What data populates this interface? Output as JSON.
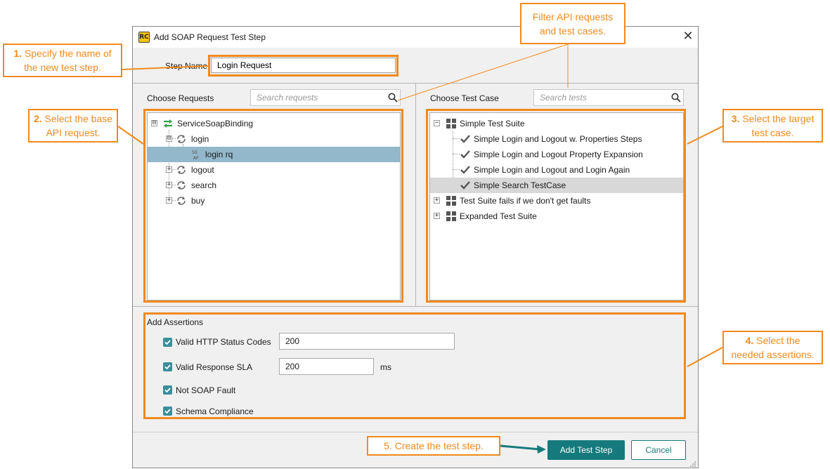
{
  "dialog": {
    "title": "Add SOAP Request Test Step",
    "app_icon_text": "RC",
    "close_glyph": "✕",
    "step_name_label": "Step Name:",
    "step_name_value": "Login Request"
  },
  "requests_pane": {
    "label": "Choose Requests",
    "search_placeholder": "Search requests",
    "tree": [
      {
        "label": "ServiceSoapBinding",
        "expander": "⊟",
        "icon": "binding-icon"
      },
      {
        "label": "login",
        "expander": "⊟",
        "icon": "operation-icon"
      },
      {
        "label": "login rq",
        "icon": "soap-request-icon",
        "selected": true
      },
      {
        "label": "logout",
        "expander": "+",
        "icon": "operation-icon"
      },
      {
        "label": "search",
        "expander": "+",
        "icon": "operation-icon"
      },
      {
        "label": "buy",
        "expander": "+",
        "icon": "operation-icon"
      }
    ]
  },
  "testcase_pane": {
    "label": "Choose Test Case",
    "search_placeholder": "Search tests",
    "tree": [
      {
        "label": "Simple Test Suite",
        "expander": "−",
        "icon": "test-suite-icon"
      },
      {
        "label": "Simple Login and Logout w. Properties Steps",
        "icon": "checkmark-icon"
      },
      {
        "label": "Simple Login and Logout Property Expansion",
        "icon": "checkmark-icon"
      },
      {
        "label": "Simple Login and Logout and Login Again",
        "icon": "checkmark-icon"
      },
      {
        "label": "Simple Search TestCase",
        "icon": "checkmark-icon",
        "selected": true
      },
      {
        "label": "Test Suite fails if we don't get faults",
        "expander": "+",
        "icon": "test-suite-icon"
      },
      {
        "label": "Expanded Test Suite",
        "expander": "+",
        "icon": "test-suite-icon"
      }
    ]
  },
  "assertions": {
    "title": "Add Assertions",
    "items": [
      {
        "label": "Valid HTTP Status Codes",
        "checked": true,
        "value": "200"
      },
      {
        "label": "Valid Response SLA",
        "checked": true,
        "value": "200",
        "unit": "ms"
      },
      {
        "label": "Not SOAP Fault",
        "checked": true
      },
      {
        "label": "Schema Compliance",
        "checked": true
      }
    ]
  },
  "buttons": {
    "add": "Add Test Step",
    "cancel": "Cancel"
  },
  "callouts": {
    "c1_num": "1.",
    "c1_line1": "Specify the name of",
    "c1_line2": "the new test step.",
    "c2_num": "2.",
    "c2_line1": "Select the base",
    "c2_line2": "API request.",
    "c3_num": "3.",
    "c3_line1": "Select the target",
    "c3_line2": "test case.",
    "c4_num": "4.",
    "c4_line1": "Select the",
    "c4_line2": "needed assertions.",
    "c5": "5. Create the test step.",
    "filter_line1": "Filter API requests",
    "filter_line2": "and test cases."
  },
  "colors": {
    "accent_orange": "#f28a1c",
    "primary_teal": "#167a7d",
    "selection_blue": "#93b7cb",
    "checkbox_teal": "#3b8e9b"
  }
}
